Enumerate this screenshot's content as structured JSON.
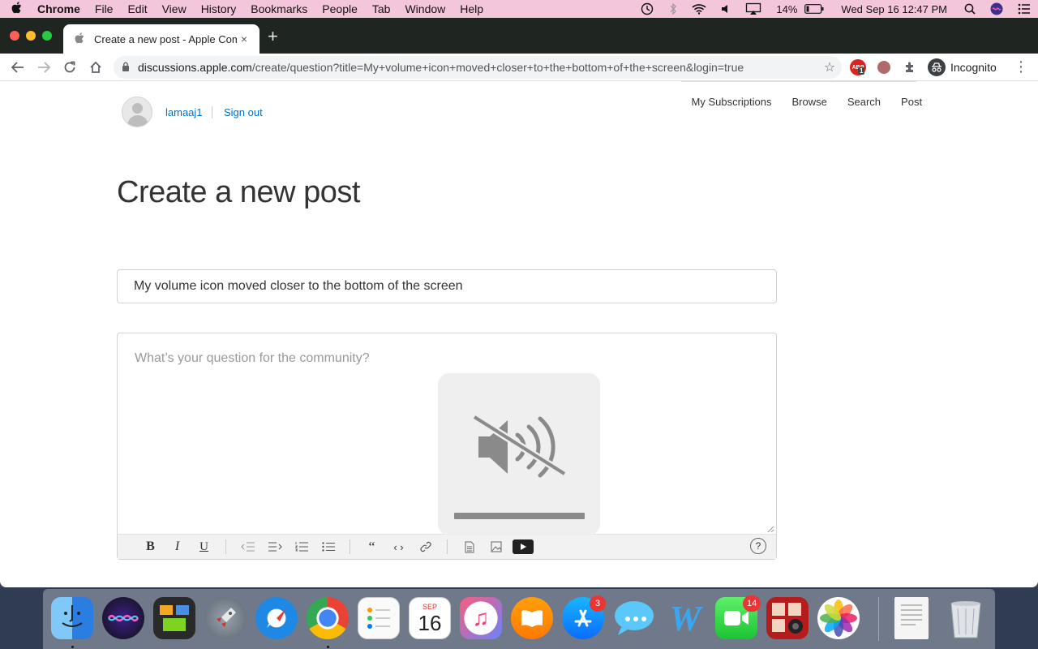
{
  "menubar": {
    "apple": "",
    "items": [
      "Chrome",
      "File",
      "Edit",
      "View",
      "History",
      "Bookmarks",
      "People",
      "Tab",
      "Window",
      "Help"
    ],
    "battery": "14%",
    "datetime": "Wed Sep 16  12:47 PM"
  },
  "browser": {
    "tab_title": "Create a new post - Apple Com",
    "tab_close": "×",
    "new_tab": "+",
    "url_host": "discussions.apple.com",
    "url_path": "/create/question?title=My+volume+icon+moved+closer+to+the+bottom+of+the+screen&login=true",
    "abp_badge": "1",
    "abp_label": "ABP",
    "incognito_label": "Incognito"
  },
  "page": {
    "username": "lamaaj1",
    "signout": "Sign out",
    "nav": [
      "My Subscriptions",
      "Browse",
      "Search",
      "Post"
    ],
    "title": "Create a new post",
    "post_title_value": "My volume icon moved closer to the bottom of the screen",
    "body_placeholder": "What’s your question for the community?",
    "toolbar": {
      "bold": "B",
      "italic": "I",
      "underline": "U",
      "quote": "“",
      "code": "‹ ›",
      "help": "?"
    }
  },
  "volume_hud": {
    "state": "muted",
    "level": 0.0
  },
  "dock": {
    "calendar_month": "SEP",
    "calendar_day": "16",
    "app_store_badge": "3",
    "facetime_badge": "14"
  },
  "colors": {
    "menubar_bg": "#f3c6dc",
    "link": "#0070c9",
    "tabstrip_bg": "#1f2520"
  }
}
